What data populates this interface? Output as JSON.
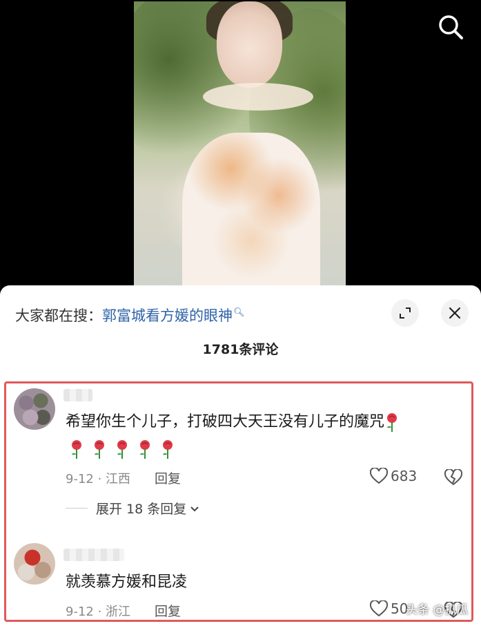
{
  "search_bar": {
    "prefix": "大家都在搜：",
    "query": "郭富城看方媛的眼神"
  },
  "comment_count": "1781条评论",
  "comments": [
    {
      "text": "希望你生个儿子，打破四大天王没有儿子的魔咒",
      "meta": "9-12 · 江西",
      "reply_label": "回复",
      "likes": "683",
      "expand_label": "展开 18 条回复"
    },
    {
      "text": "就羡慕方媛和昆凌",
      "meta": "9-12 · 浙江",
      "reply_label": "回复",
      "likes": "50"
    }
  ],
  "watermark": "头条 @扒瓜",
  "icons": {
    "search": "search-icon",
    "expand": "expand-icon",
    "close": "close-icon",
    "like": "heart-icon",
    "dislike": "broken-heart-icon",
    "rose": "rose-emoji-icon"
  },
  "colors": {
    "link": "#2e63a8",
    "highlight_border": "#e0595b",
    "meta_text": "#8a8a8a"
  }
}
